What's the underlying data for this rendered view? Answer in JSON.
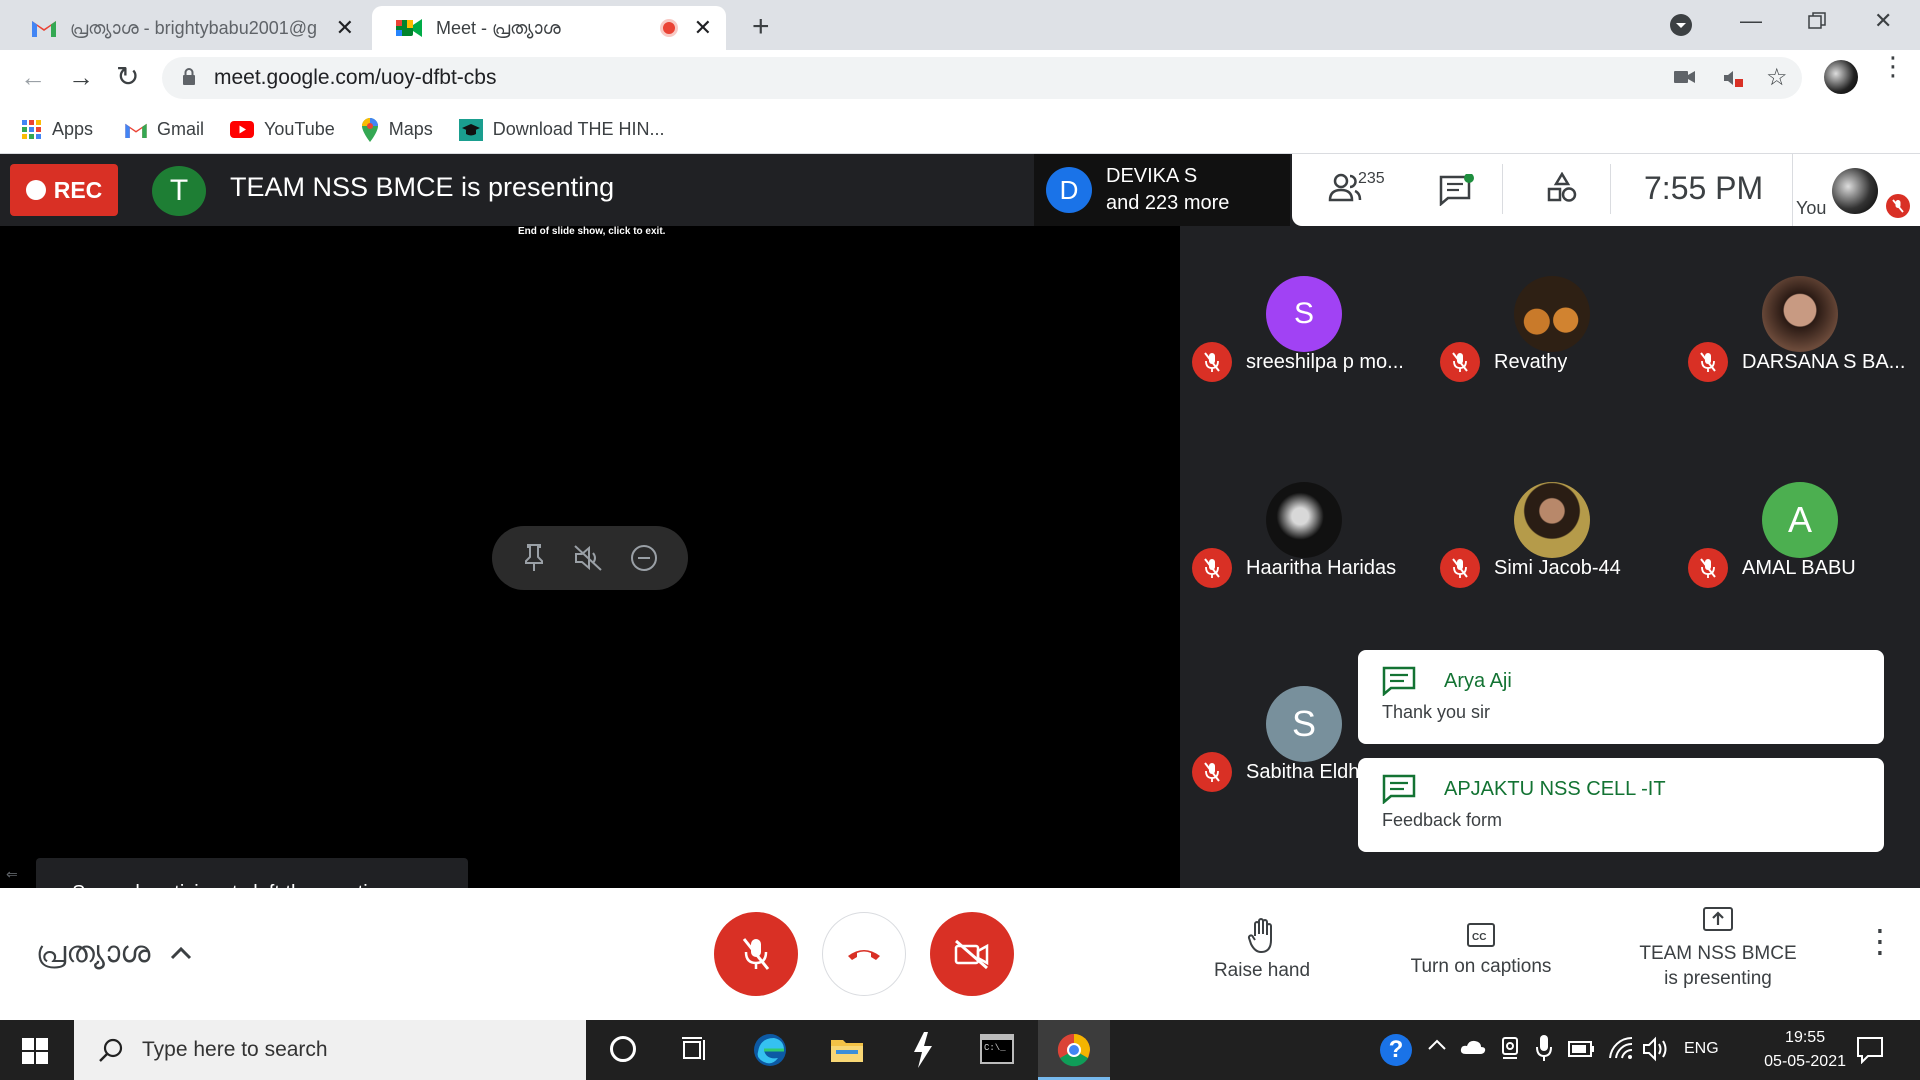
{
  "browser": {
    "tabs": [
      {
        "label": "പ്രത്യാശ - brightybabu2001@g",
        "icon": "gmail-icon",
        "active": false
      },
      {
        "label": "Meet - പ്രത്യാശ",
        "icon": "meet-icon",
        "active": true
      }
    ],
    "url": "meet.google.com/uoy-dfbt-cbs",
    "bookmarks": [
      "Apps",
      "Gmail",
      "YouTube",
      "Maps",
      "Download THE HIN..."
    ]
  },
  "meet": {
    "rec_label": "REC",
    "presenter_initial": "T",
    "presenting_title": "TEAM NSS BMCE is presenting",
    "slide_note": "End of slide show, click to exit.",
    "others_initial": "D",
    "others_name": "DEVIKA S",
    "others_more": "and 223 more",
    "participant_count": "235",
    "time": "7:55 PM",
    "you_label": "You",
    "participants": [
      {
        "name": "sreeshilpa p mo...",
        "initial": "S",
        "color": "#a142f4",
        "photo": false
      },
      {
        "name": "Revathy",
        "initial": "",
        "color": "#3a2a1a",
        "photo": true
      },
      {
        "name": "DARSANA S BA...",
        "initial": "",
        "color": "#6b4a3a",
        "photo": true
      },
      {
        "name": "Haaritha Haridas",
        "initial": "",
        "color": "#111111",
        "photo": true
      },
      {
        "name": "Simi Jacob-44",
        "initial": "",
        "color": "#5a4a30",
        "photo": true
      },
      {
        "name": "AMAL BABU",
        "initial": "A",
        "color": "#4caf50",
        "photo": false
      },
      {
        "name": "Sabitha Eldh",
        "initial": "S",
        "color": "#78909c",
        "photo": false
      }
    ],
    "chats": [
      {
        "sender": "Arya Aji",
        "message": "Thank you sir"
      },
      {
        "sender": "APJAKTU NSS CELL -IT",
        "message": "Feedback form"
      }
    ],
    "toast": "Several participants left the meeting.",
    "meeting_name": "പ്രത്യാശ",
    "controls": {
      "raise_hand": "Raise hand",
      "captions": "Turn on captions",
      "presenting_line1": "TEAM NSS BMCE",
      "presenting_line2": "is presenting"
    }
  },
  "taskbar": {
    "search_placeholder": "Type here to search",
    "lang": "ENG",
    "time": "19:55",
    "date": "05-05-2021"
  },
  "colors": {
    "danger": "#d93025",
    "meet_dark": "#202124",
    "accent_green": "#137333"
  }
}
